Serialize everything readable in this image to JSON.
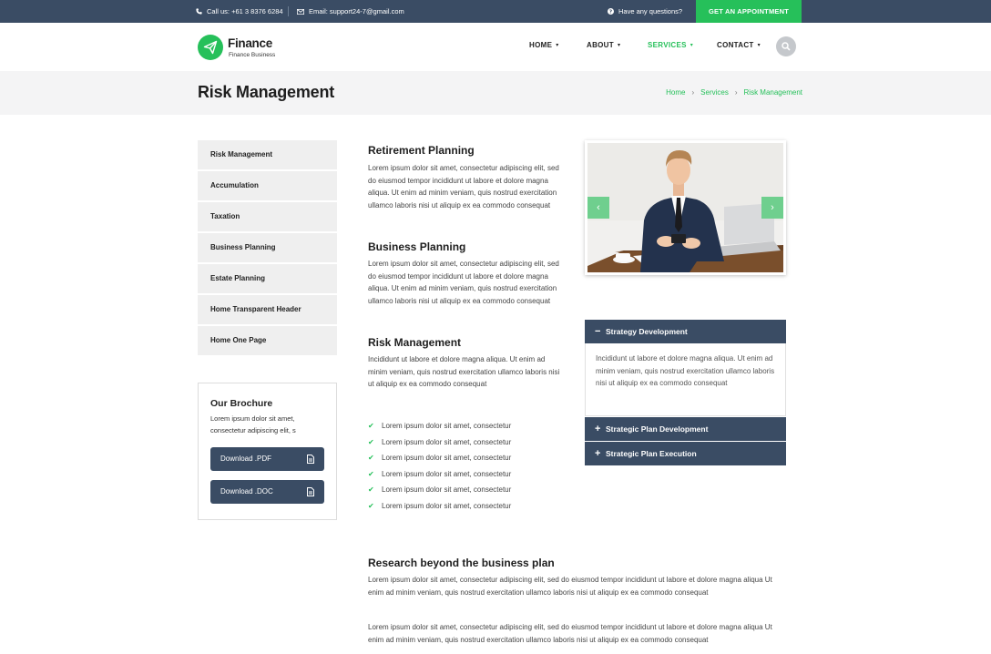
{
  "topbar": {
    "phone": "Call us: +61 3 8376 6284",
    "email": "Email: support24-7@gmail.com",
    "question": "Have any questions?",
    "appointment": "GET AN APPOINTMENT"
  },
  "brand": {
    "name": "Finance",
    "tagline": "Finance Business",
    "accent": "#26c05a",
    "navy": "#3a4c64"
  },
  "nav": {
    "home": "HOME",
    "about": "ABOUT",
    "services": "SERVICES",
    "contact": "CONTACT"
  },
  "page": {
    "title": "Risk Management",
    "breadcrumb": [
      "Home",
      "Services",
      "Risk Management"
    ]
  },
  "sidebar": {
    "items": [
      {
        "label": "Risk Management"
      },
      {
        "label": "Accumulation"
      },
      {
        "label": "Taxation"
      },
      {
        "label": "Business Planning"
      },
      {
        "label": "Estate Planning"
      },
      {
        "label": "Home Transparent Header"
      },
      {
        "label": "Home One Page"
      }
    ],
    "brochure": {
      "title": "Our Brochure",
      "text": "Lorem ipsum dolor sit amet, consectetur adipiscing elit, s",
      "pdf": "Download .PDF",
      "doc": "Download .DOC"
    }
  },
  "content": {
    "sections": [
      {
        "title": "Retirement Planning",
        "body": "Lorem ipsum dolor sit amet, consectetur adipiscing elit, sed do eiusmod tempor incididunt ut labore et dolore magna aliqua. Ut enim ad minim veniam, quis nostrud exercitation ullamco laboris nisi ut aliquip ex ea commodo consequat"
      },
      {
        "title": "Business Planning",
        "body": "Lorem ipsum dolor sit amet, consectetur adipiscing elit, sed do eiusmod tempor incididunt ut labore et dolore magna aliqua. Ut enim ad minim veniam, quis nostrud exercitation ullamco laboris nisi ut aliquip ex ea commodo consequat"
      },
      {
        "title": "Risk Management",
        "body": "Incididunt ut labore et dolore magna aliqua. Ut enim ad minim veniam, quis nostrud exercitation ullamco laboris nisi ut aliquip ex ea commodo consequat"
      }
    ],
    "checklist": [
      "Lorem ipsum dolor sit amet, consectetur",
      "Lorem ipsum dolor sit amet, consectetur",
      "Lorem ipsum dolor sit amet, consectetur",
      "Lorem ipsum dolor sit amet, consectetur",
      "Lorem ipsum dolor sit amet, consectetur",
      "Lorem ipsum dolor sit amet, consectetur"
    ],
    "research": {
      "title": "Research beyond the business plan",
      "p1": "Lorem ipsum dolor sit amet, consectetur adipiscing elit, sed do eiusmod tempor incididunt ut labore et dolore magna aliqua Ut enim ad minim veniam, quis nostrud exercitation ullamco laboris nisi ut aliquip ex ea commodo consequat",
      "p2": "Lorem ipsum dolor sit amet, consectetur adipiscing elit, sed do eiusmod tempor incididunt ut labore et dolore magna aliqua Ut enim ad minim veniam, quis nostrud exercitation ullamco laboris nisi ut aliquip ex ea commodo consequat"
    }
  },
  "accordion": {
    "open": {
      "title": "Strategy Development",
      "body": "Incididunt ut labore et dolore magna aliqua. Ut enim ad minim veniam, quis nostrud exercitation ullamco laboris nisi ut aliquip ex ea commodo consequat"
    },
    "closed": [
      {
        "title": "Strategic Plan Development"
      },
      {
        "title": "Strategic Plan Execution"
      }
    ]
  },
  "icons": {
    "phone": "phone-icon",
    "email": "email-icon",
    "question": "question-circle-icon",
    "search": "search-icon",
    "check": "check-icon",
    "document": "document-icon",
    "minus": "minus-icon",
    "plus": "plus-icon",
    "prev": "chevron-left-icon",
    "next": "chevron-right-icon"
  }
}
